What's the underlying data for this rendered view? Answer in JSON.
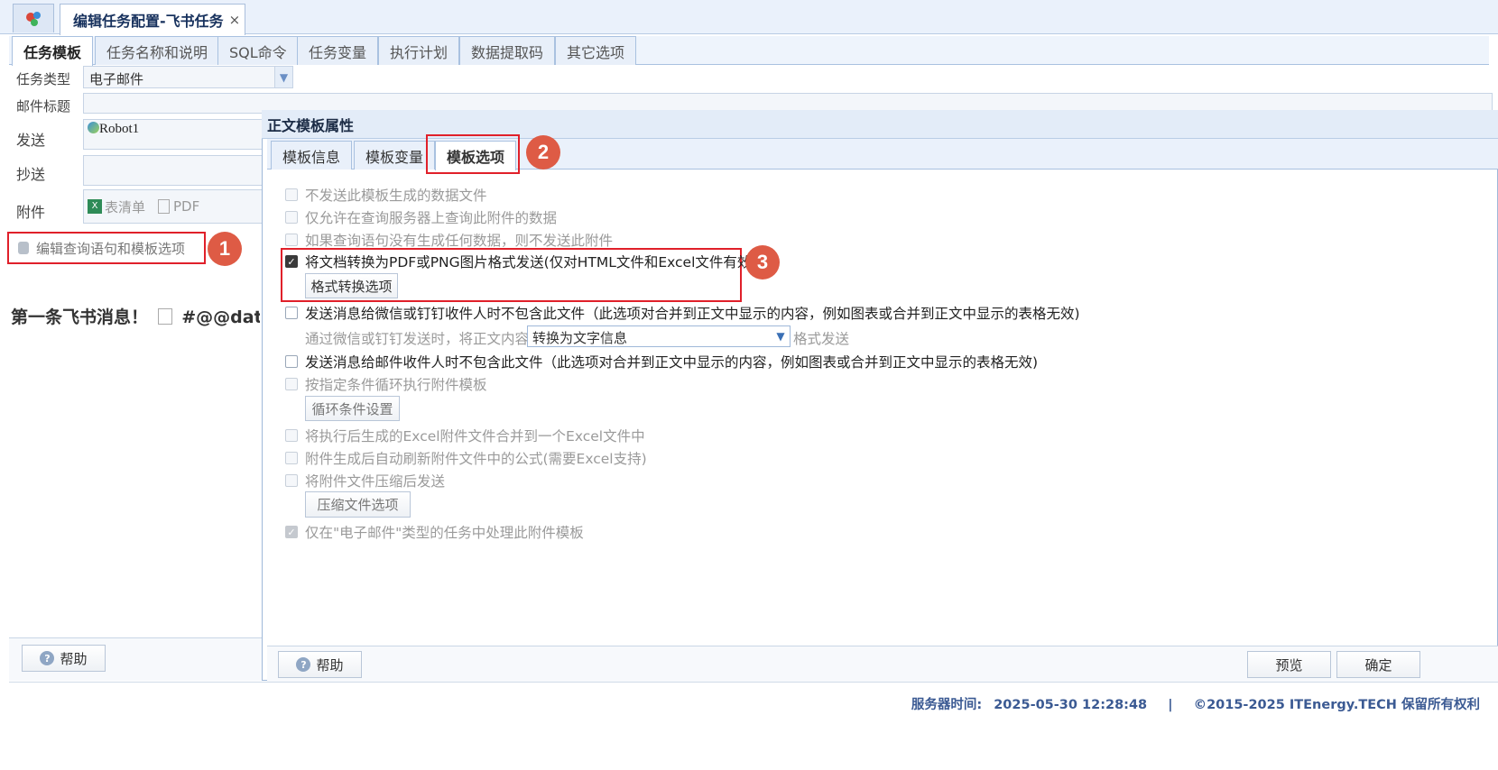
{
  "window": {
    "tab_title": "编辑任务配置-飞书任务",
    "tab_close": "×"
  },
  "main_tabs": [
    "任务模板",
    "任务名称和说明",
    "SQL命令",
    "任务变量",
    "执行计划",
    "数据提取码",
    "其它选项"
  ],
  "form": {
    "task_type_label": "任务类型",
    "task_type_value": "电子邮件",
    "subject_label": "邮件标题",
    "send_label": "发送",
    "send_value": "Robot1",
    "cc_label": "抄送",
    "attach_label": "附件",
    "attach_item1": "表清单",
    "attach_item2": "PDF",
    "edit_button": "编辑查询语句和模板选项",
    "body_preview": "第一条飞书消息！",
    "body_preview_var": "#@@datet",
    "help_button": "帮助"
  },
  "badges": [
    "1",
    "2",
    "3"
  ],
  "dialog": {
    "title": "正文模板属性",
    "tabs": [
      "模板信息",
      "模板变量",
      "模板选项"
    ],
    "options": {
      "opt1": "不发送此模板生成的数据文件",
      "opt2": "仅允许在查询服务器上查询此附件的数据",
      "opt3": "如果查询语句没有生成任何数据，则不发送此附件",
      "opt4": "将文档转换为PDF或PNG图片格式发送(仅对HTML文件和Excel文件有效)",
      "opt4_button": "格式转换选项",
      "opt5": "发送消息给微信或钉钉收件人时不包含此文件（此选项对合并到正文中显示的内容，例如图表或合并到正文中显示的表格无效)",
      "opt5_sub_prefix": "通过微信或钉钉发送时，将正文内容",
      "opt5_sub_select": "转换为文字信息",
      "opt5_sub_suffix": "格式发送",
      "opt6": "发送消息给邮件收件人时不包含此文件（此选项对合并到正文中显示的内容，例如图表或合并到正文中显示的表格无效)",
      "opt7": "按指定条件循环执行附件模板",
      "opt7_button": "循环条件设置",
      "opt8": "将执行后生成的Excel附件文件合并到一个Excel文件中",
      "opt9": "附件生成后自动刷新附件文件中的公式(需要Excel支持)",
      "opt10": "将附件文件压缩后发送",
      "opt10_button": "压缩文件选项",
      "opt11": "仅在\"电子邮件\"类型的任务中处理此附件模板"
    },
    "footer": {
      "help": "帮助",
      "preview": "预览",
      "ok": "确定"
    }
  },
  "status": {
    "server_time_label": "服务器时间:",
    "server_time": "2025-05-30 12:28:48",
    "sep": "|",
    "copyright": "©2015-2025 ITEnergy.TECH 保留所有权利"
  },
  "colors": {
    "accent": "#e0202a",
    "badge": "#de5b45",
    "status_text": "#3b5a93"
  }
}
